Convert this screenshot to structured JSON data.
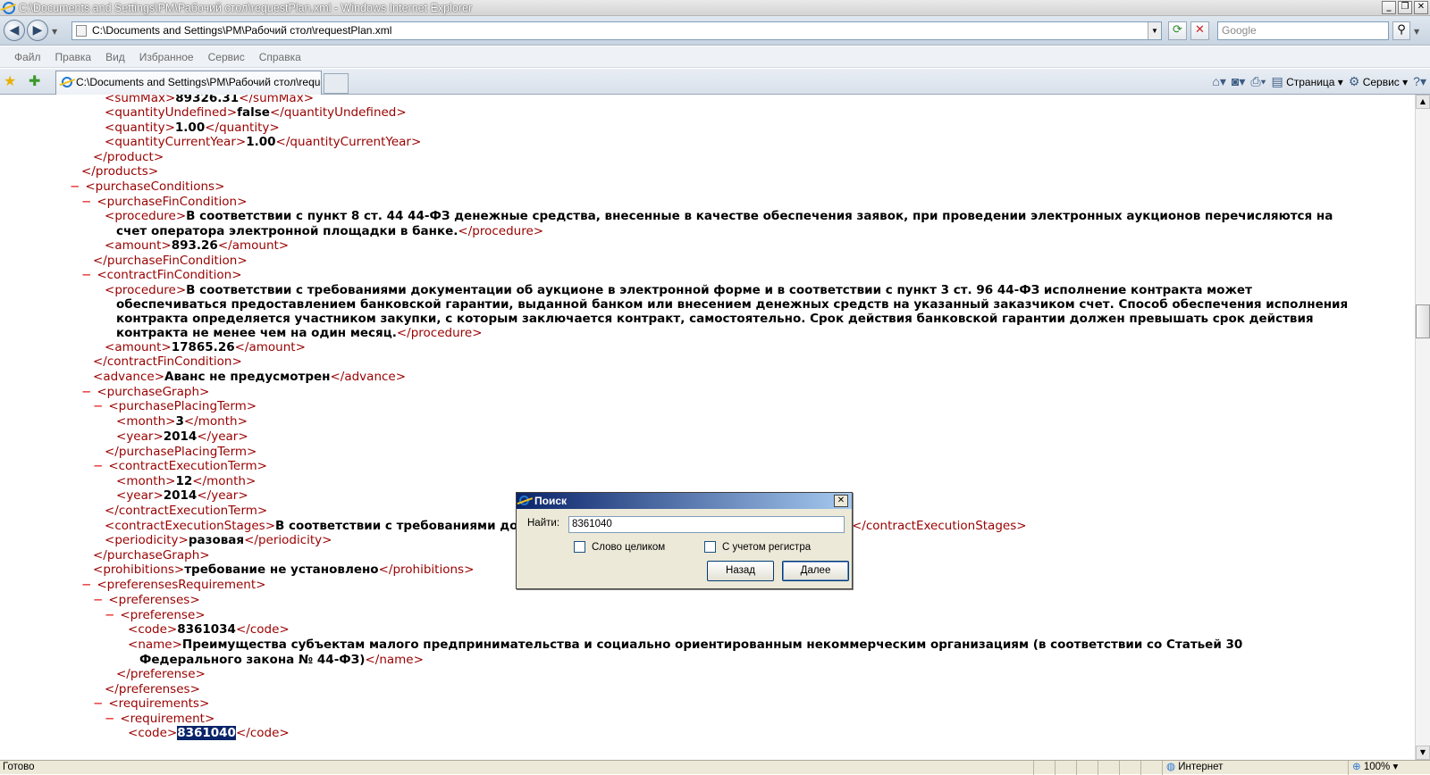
{
  "window": {
    "title": "C:\\Documents and Settings\\PM\\Рабочий стол\\requestPlan.xml - Windows Internet Explorer",
    "btn_min": "_",
    "btn_max": "❐",
    "btn_close": "✕"
  },
  "address": {
    "url": "C:\\Documents and Settings\\PM\\Рабочий стол\\requestPlan.xml",
    "search_placeholder": "Google"
  },
  "menu": [
    "Файл",
    "Правка",
    "Вид",
    "Избранное",
    "Сервис",
    "Справка"
  ],
  "tab": {
    "title": "C:\\Documents and Settings\\PM\\Рабочий стол\\reques..."
  },
  "command_bar": {
    "page": "Страница",
    "tools": "Сервис"
  },
  "xml": {
    "l1": {
      "o": "sumMax",
      "v": "89326.31",
      "c": "sumMax"
    },
    "l2": {
      "o": "quantityUndefined",
      "v": "false",
      "c": "quantityUndefined"
    },
    "l3": {
      "o": "quantity",
      "v": "1.00",
      "c": "quantity"
    },
    "l4": {
      "o": "quantityCurrentYear",
      "v": "1.00",
      "c": "quantityCurrentYear"
    },
    "l5": "product",
    "l6": "products",
    "l7": "purchaseConditions",
    "l8": "purchaseFinCondition",
    "l9_tag": "procedure",
    "l9_v1": "В соответствии с пункт 8 ст. 44 44-ФЗ денежные средства, внесенные в качестве обеспечения заявок, при проведении электронных аукционов перечисляются на",
    "l9_v2": "счет оператора электронной площадки в банке.",
    "l10": {
      "o": "amount",
      "v": "893.26",
      "c": "amount"
    },
    "l11": "purchaseFinCondition",
    "l12": "contractFinCondition",
    "l13_tag": "procedure",
    "l13_v1": "В соответствии с требованиями документации об аукционе в электронной форме и в соответствии с пункт 3 ст. 96 44-ФЗ исполнение контракта может",
    "l13_v2": "обеспечиваться предоставлением банковской гарантии, выданной банком или внесением денежных средств на указанный заказчиком счет. Способ обеспечения исполнения",
    "l13_v3": "контракта определяется участником закупки, с которым заключается контракт, самостоятельно. Срок действия банковской гарантии должен превышать срок действия",
    "l13_v4": "контракта не менее чем на один месяц.",
    "l14": {
      "o": "amount",
      "v": "17865.26",
      "c": "amount"
    },
    "l15": "contractFinCondition",
    "l16": {
      "o": "advance",
      "v": "Аванс не предусмотрен",
      "c": "advance"
    },
    "l17": "purchaseGraph",
    "l18": "purchasePlacingTerm",
    "l19": {
      "o": "month",
      "v": "3",
      "c": "month"
    },
    "l20": {
      "o": "year",
      "v": "2014",
      "c": "year"
    },
    "l21": "purchasePlacingTerm",
    "l22": "contractExecutionTerm",
    "l23": {
      "o": "month",
      "v": "12",
      "c": "month"
    },
    "l24": {
      "o": "year",
      "v": "2014",
      "c": "year"
    },
    "l25": "contractExecutionTerm",
    "l26": {
      "o": "contractExecutionStages",
      "v": "В соответствии с требованиями доку",
      "c": "contractExecutionStages"
    },
    "l27": {
      "o": "periodicity",
      "v": "разовая",
      "c": "periodicity"
    },
    "l28": "purchaseGraph",
    "l29": {
      "o": "prohibitions",
      "v": "требование не установлено",
      "c": "prohibitions"
    },
    "l30": "preferensesRequirement",
    "l31": "preferenses",
    "l32": "preferense",
    "l33": {
      "o": "code",
      "v": "8361034",
      "c": "code"
    },
    "l34_tag": "name",
    "l34_v1": "Преимущества субъектам малого предпринимательства и социально ориентированным некоммерческим организациям (в соответствии со Статьей 30",
    "l34_v2": "Федерального закона № 44-ФЗ)",
    "l35": "preferense",
    "l36": "preferenses",
    "l37": "requirements",
    "l38": "requirement",
    "l39": {
      "o": "code",
      "v": "8361040",
      "c": "code"
    },
    "minus": "−"
  },
  "dialog": {
    "title": "Поиск",
    "find_label": "Найти:",
    "find_value": "8361040",
    "whole_word": "Слово целиком",
    "match_case": "С учетом регистра",
    "prev": "Назад",
    "next": "Далее"
  },
  "status": {
    "text": "Готово",
    "zone": "Интернет",
    "zoom": "100%"
  }
}
